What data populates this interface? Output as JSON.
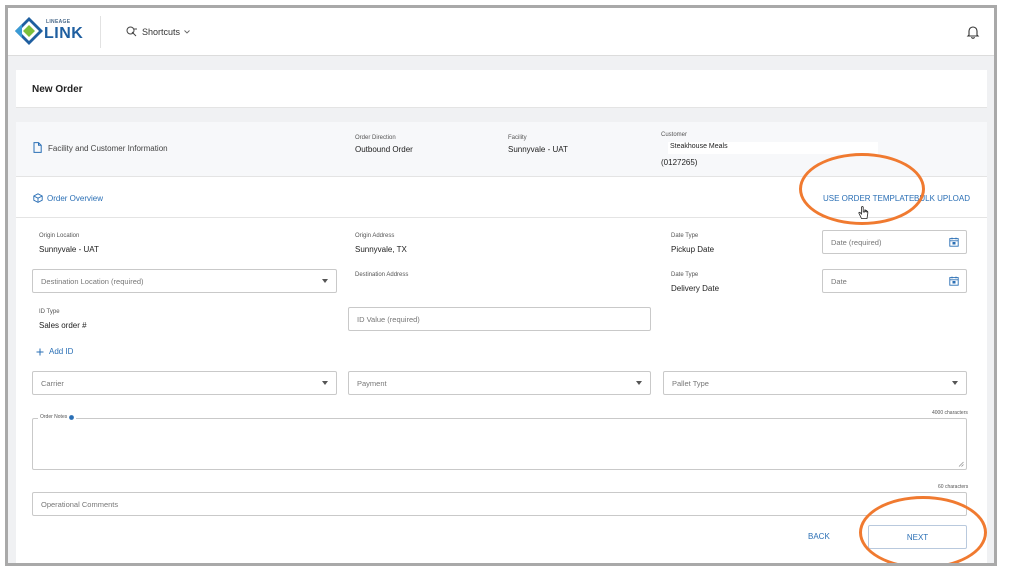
{
  "header": {
    "logo_small": "LINEAGE",
    "logo_main": "LINK",
    "shortcuts_label": "Shortcuts",
    "icons": [
      "logo-diamond-icon",
      "shortcuts-icon",
      "chevron-down-icon",
      "bell-icon"
    ]
  },
  "page": {
    "title": "New Order"
  },
  "facility_info": {
    "section_label": "Facility and Customer Information",
    "order_direction_label": "Order Direction",
    "order_direction_value": "Outbound Order",
    "facility_label": "Facility",
    "facility_value": "Sunnyvale - UAT",
    "customer_label": "Customer",
    "customer_name": "Steakhouse Meals",
    "customer_id": "(0127265)"
  },
  "overview": {
    "section_label": "Order Overview",
    "use_template_label": "USE ORDER TEMPLATE",
    "bulk_upload_label": "BULK UPLOAD"
  },
  "form": {
    "origin_location_label": "Origin Location",
    "origin_location_value": "Sunnyvale - UAT",
    "origin_address_label": "Origin Address",
    "origin_address_value": "Sunnyvale, TX",
    "date_type_label_1": "Date Type",
    "date_type_value_1": "Pickup Date",
    "date_required_placeholder": "Date (required)",
    "destination_location_placeholder": "Destination Location (required)",
    "destination_address_label": "Destination Address",
    "date_type_label_2": "Date Type",
    "date_type_value_2": "Delivery Date",
    "date_placeholder": "Date",
    "id_type_label": "ID Type",
    "id_type_value": "Sales order #",
    "id_value_placeholder": "ID Value (required)",
    "add_id_label": "Add ID",
    "carrier_placeholder": "Carrier",
    "payment_placeholder": "Payment",
    "pallet_type_placeholder": "Pallet Type",
    "order_notes_label": "Order Notes",
    "order_notes_limit": "4000 characters",
    "operational_comments_limit": "60 characters",
    "operational_comments_placeholder": "Operational Comments"
  },
  "actions": {
    "back_label": "BACK",
    "next_label": "NEXT"
  },
  "colors": {
    "accent": "#2a6fb5",
    "highlight_circle": "#f07a30"
  }
}
